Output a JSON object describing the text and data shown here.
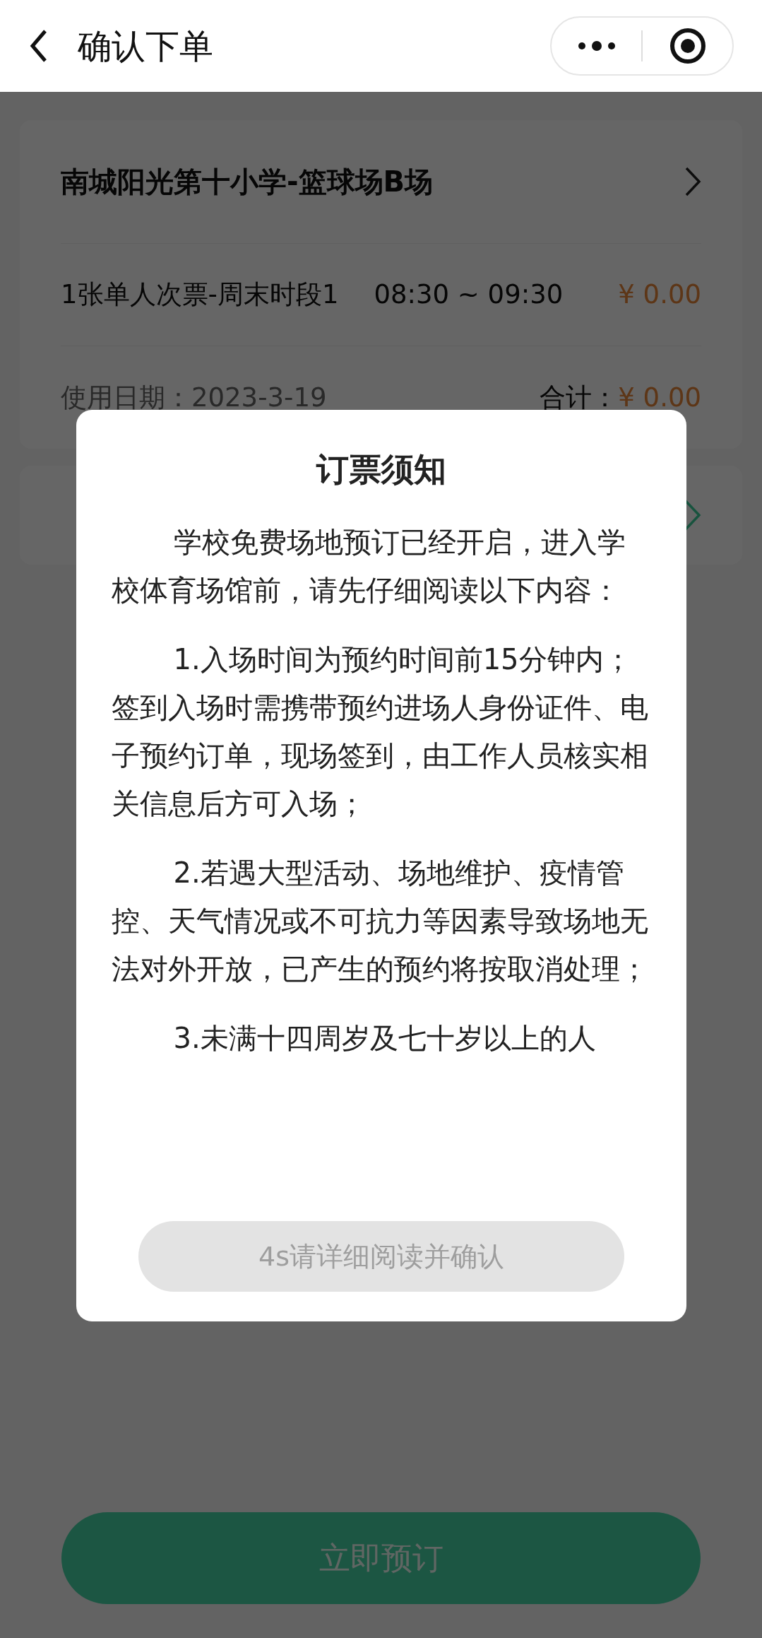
{
  "header": {
    "title": "确认下单"
  },
  "venue": {
    "name": "南城阳光第十小学-篮球场B场"
  },
  "ticket": {
    "name": "1张单人次票-周末时段1",
    "time": "08:30 ~ 09:30",
    "price": "¥ 0.00"
  },
  "summary": {
    "date_label": "使用日期：",
    "date": "2023-3-19",
    "total_label": "合计：",
    "total": "¥ 0.00"
  },
  "dialog": {
    "title": "订票须知",
    "paragraphs": [
      "学校免费场地预订已经开启，进入学校体育场馆前，请先仔细阅读以下内容：",
      "1.入场时间为预约时间前15分钟内；签到入场时需携带预约进场人身份证件、电子预约订单，现场签到，由工作人员核实相关信息后方可入场；",
      "2.若遇大型活动、场地维护、疫情管控、天气情况或不可抗力等因素导致场地无法对外开放，已产生的预约将按取消处理；",
      "3.未满十四周岁及七十岁以上的人"
    ],
    "confirm_button": {
      "label": "4s请详细阅读并确认",
      "disabled": true
    }
  },
  "book_button": {
    "label": "立即预订"
  }
}
